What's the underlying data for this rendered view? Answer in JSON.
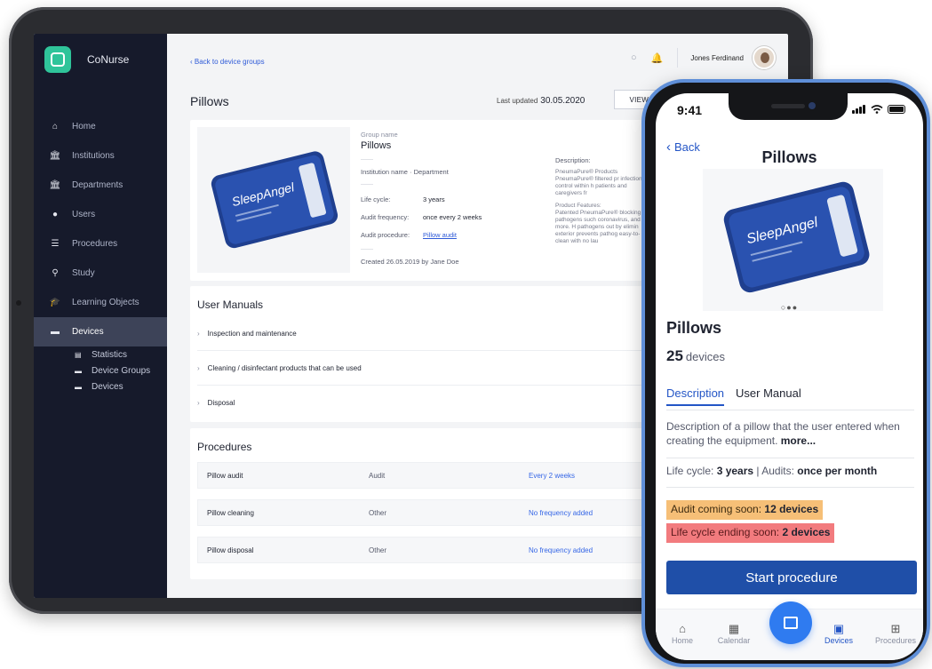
{
  "tablet": {
    "brand": "CoNurse",
    "nav": [
      "Home",
      "Institutions",
      "Departments",
      "Users",
      "Procedures",
      "Study",
      "Learning Objects",
      "Devices"
    ],
    "subnav": [
      "Statistics",
      "Device Groups",
      "Devices"
    ],
    "back_link": "Back to device groups",
    "user_name": "Jones Ferdinand",
    "page_title": "Pillows",
    "last_updated_label": "Last updated",
    "last_updated_value": "30.05.2020",
    "view_button": "VIEW ST",
    "group_name_label": "Group name",
    "group_name": "Pillows",
    "institution_line": "Institution name · Department",
    "life_cycle_label": "Life cycle:",
    "life_cycle_value": "3 years",
    "audit_freq_label": "Audit frequency:",
    "audit_freq_value": "once every 2 weeks",
    "audit_proc_label": "Audit procedure:",
    "audit_proc_value": "Pillow audit",
    "created": "Created 26.05.2019 by Jane Doe",
    "description_label": "Description:",
    "description_text": "PneumaPure® Products PneumaPure® filtered pr infection control within h patients and caregivers fr",
    "features_label": "Product Features:",
    "features_text": "Patented PneumaPure® blocking pathogens such coronavirus, and more. H pathogens out by elimin exterior prevents pathog easy-to-clean with no lau",
    "manuals_title": "User Manuals",
    "manuals": [
      "Inspection and maintenance",
      "Cleaning / disinfectant products that can be used",
      "Disposal"
    ],
    "procedures_title": "Procedures",
    "procedures": [
      {
        "name": "Pillow audit",
        "type": "Audit",
        "freq": "Every 2 weeks"
      },
      {
        "name": "Pillow cleaning",
        "type": "Other",
        "freq": "No frequency added"
      },
      {
        "name": "Pillow disposal",
        "type": "Other",
        "freq": "No frequency added"
      }
    ],
    "product_image_text": "SleepAngel"
  },
  "phone": {
    "time": "9:41",
    "back": "Back",
    "header": "Pillows",
    "name": "Pillows",
    "count": "25",
    "count_unit": "devices",
    "tab_description": "Description",
    "tab_manual": "User Manual",
    "desc_text": "Description of a pillow that the user entered when creating the equipment.",
    "desc_more": "more...",
    "life_label": "Life cycle:",
    "life_value": "3 years",
    "life_sep": "|",
    "audits_label": "Audits:",
    "audits_value": "once per month",
    "badge1_label": "Audit coming soon:",
    "badge1_value": "12 devices",
    "badge2_label": "Life cycle ending soon:",
    "badge2_value": "2 devices",
    "cta": "Start procedure",
    "bottom_nav": [
      "Home",
      "Calendar",
      "Devices",
      "Procedures"
    ],
    "product_image_text": "SleepAngel"
  },
  "colors": {
    "sidebar_bg": "#161a2b",
    "accent_blue": "#2f5bd8",
    "brand_green": "#2fc49a",
    "badge_orange": "#f6bf77",
    "badge_red": "#f27b7e",
    "cta_blue": "#1f4fa8",
    "phone_frame": "#5f8fd8"
  }
}
